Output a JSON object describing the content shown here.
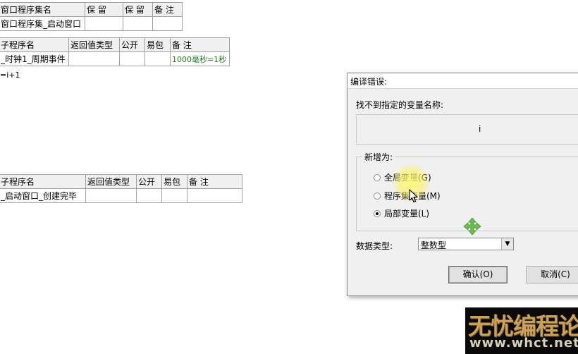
{
  "table1": {
    "headers": [
      "窗口程序集名",
      "保 留",
      "保 留",
      "备 注"
    ],
    "row": [
      "窗口程序集_启动窗口",
      "",
      "",
      ""
    ]
  },
  "table2": {
    "headers": [
      "子程序名",
      "返回值类型",
      "公开",
      "易包",
      "备 注"
    ],
    "row": [
      "_时钟1_周期事件",
      "",
      "",
      "",
      "1000毫秒=1秒"
    ]
  },
  "code_line": "=i+1",
  "table3": {
    "headers": [
      "子程序名",
      "返回值类型",
      "公开",
      "易包",
      "备 注"
    ],
    "row": [
      "_启动窗口_创建完毕",
      "",
      "",
      "",
      ""
    ]
  },
  "dialog": {
    "title": "编译错误:",
    "message_label": "找不到指定的变量名称:",
    "variable_name": "i",
    "group_title": "新增为:",
    "options": [
      {
        "label": "全局变量(G)",
        "checked": false
      },
      {
        "label": "程序集变量(M)",
        "checked": false
      },
      {
        "label": "局部变量(L)",
        "checked": true
      }
    ],
    "data_type_label": "数据类型:",
    "data_type_value": "整数型",
    "ok_label": "确认(O)",
    "cancel_label": "取消(C)"
  },
  "watermark": {
    "line1": "无忧编程论坛",
    "line2": "www.whct.net"
  },
  "colors": {
    "remark_green": "#1f7a1f",
    "move_icon": "#6cc24a",
    "highlight": "#fff15a"
  }
}
